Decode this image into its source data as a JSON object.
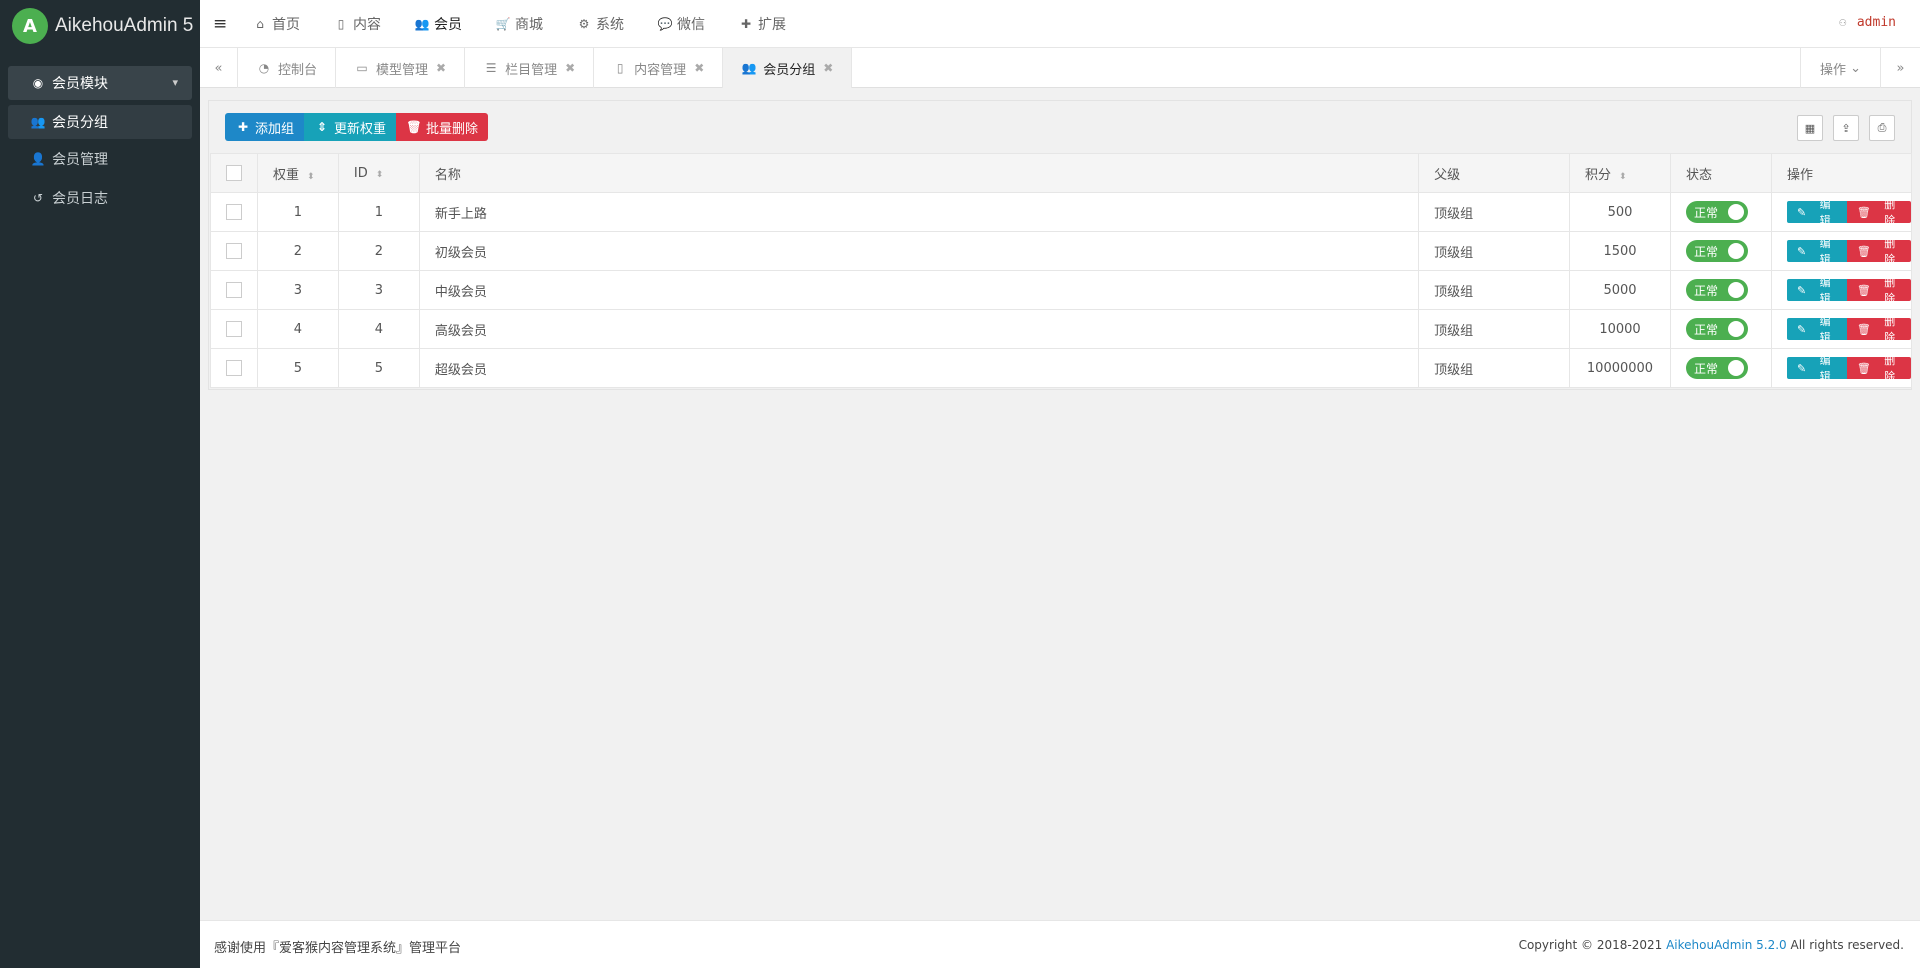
{
  "brand": {
    "logo_letter": "A",
    "name": "AikehouAdmin 5"
  },
  "sidebar": {
    "group": {
      "label": "会员模块",
      "icon": "user-circle-icon"
    },
    "items": [
      {
        "label": "会员分组",
        "icon": "users-icon",
        "active": true
      },
      {
        "label": "会员管理",
        "icon": "user-plus-icon",
        "active": false
      },
      {
        "label": "会员日志",
        "icon": "history-icon",
        "active": false
      }
    ]
  },
  "topnav": {
    "items": [
      {
        "label": "首页",
        "icon": "home-icon"
      },
      {
        "label": "内容",
        "icon": "file-icon"
      },
      {
        "label": "会员",
        "icon": "users-icon",
        "active": true
      },
      {
        "label": "商城",
        "icon": "cart-icon"
      },
      {
        "label": "系统",
        "icon": "cogs-icon"
      },
      {
        "label": "微信",
        "icon": "wechat-icon"
      },
      {
        "label": "扩展",
        "icon": "plus-icon"
      }
    ],
    "user": "admin"
  },
  "tabs": {
    "items": [
      {
        "label": "控制台",
        "closable": false
      },
      {
        "label": "模型管理",
        "closable": true
      },
      {
        "label": "栏目管理",
        "closable": true
      },
      {
        "label": "内容管理",
        "closable": true
      },
      {
        "label": "会员分组",
        "closable": true,
        "active": true
      }
    ],
    "ops_label": "操作"
  },
  "toolbar": {
    "add_label": "添加组",
    "update_label": "更新权重",
    "delete_label": "批量删除"
  },
  "table": {
    "headers": {
      "weight": "权重",
      "id": "ID",
      "name": "名称",
      "parent": "父级",
      "points": "积分",
      "status": "状态",
      "actions": "操作"
    },
    "rows": [
      {
        "weight": "1",
        "id": "1",
        "name": "新手上路",
        "parent": "顶级组",
        "points": "500",
        "status": "正常",
        "edit": "编辑",
        "del": "删除"
      },
      {
        "weight": "2",
        "id": "2",
        "name": "初级会员",
        "parent": "顶级组",
        "points": "1500",
        "status": "正常",
        "edit": "编辑",
        "del": "删除"
      },
      {
        "weight": "3",
        "id": "3",
        "name": "中级会员",
        "parent": "顶级组",
        "points": "5000",
        "status": "正常",
        "edit": "编辑",
        "del": "删除"
      },
      {
        "weight": "4",
        "id": "4",
        "name": "高级会员",
        "parent": "顶级组",
        "points": "10000",
        "status": "正常",
        "edit": "编辑",
        "del": "删除"
      },
      {
        "weight": "5",
        "id": "5",
        "name": "超级会员",
        "parent": "顶级组",
        "points": "10000000",
        "status": "正常",
        "edit": "编辑",
        "del": "删除"
      }
    ]
  },
  "footer": {
    "left": "感谢使用『爱客猴内容管理系统』管理平台",
    "copyright": "Copyright © 2018-2021",
    "product": "AikehouAdmin 5.2.0",
    "rights": "All rights reserved."
  },
  "colors": {
    "sidebar": "#222d32",
    "primary": "#1e88c8",
    "teal": "#17a2b8",
    "danger": "#dc3545",
    "success": "#4caf50"
  }
}
